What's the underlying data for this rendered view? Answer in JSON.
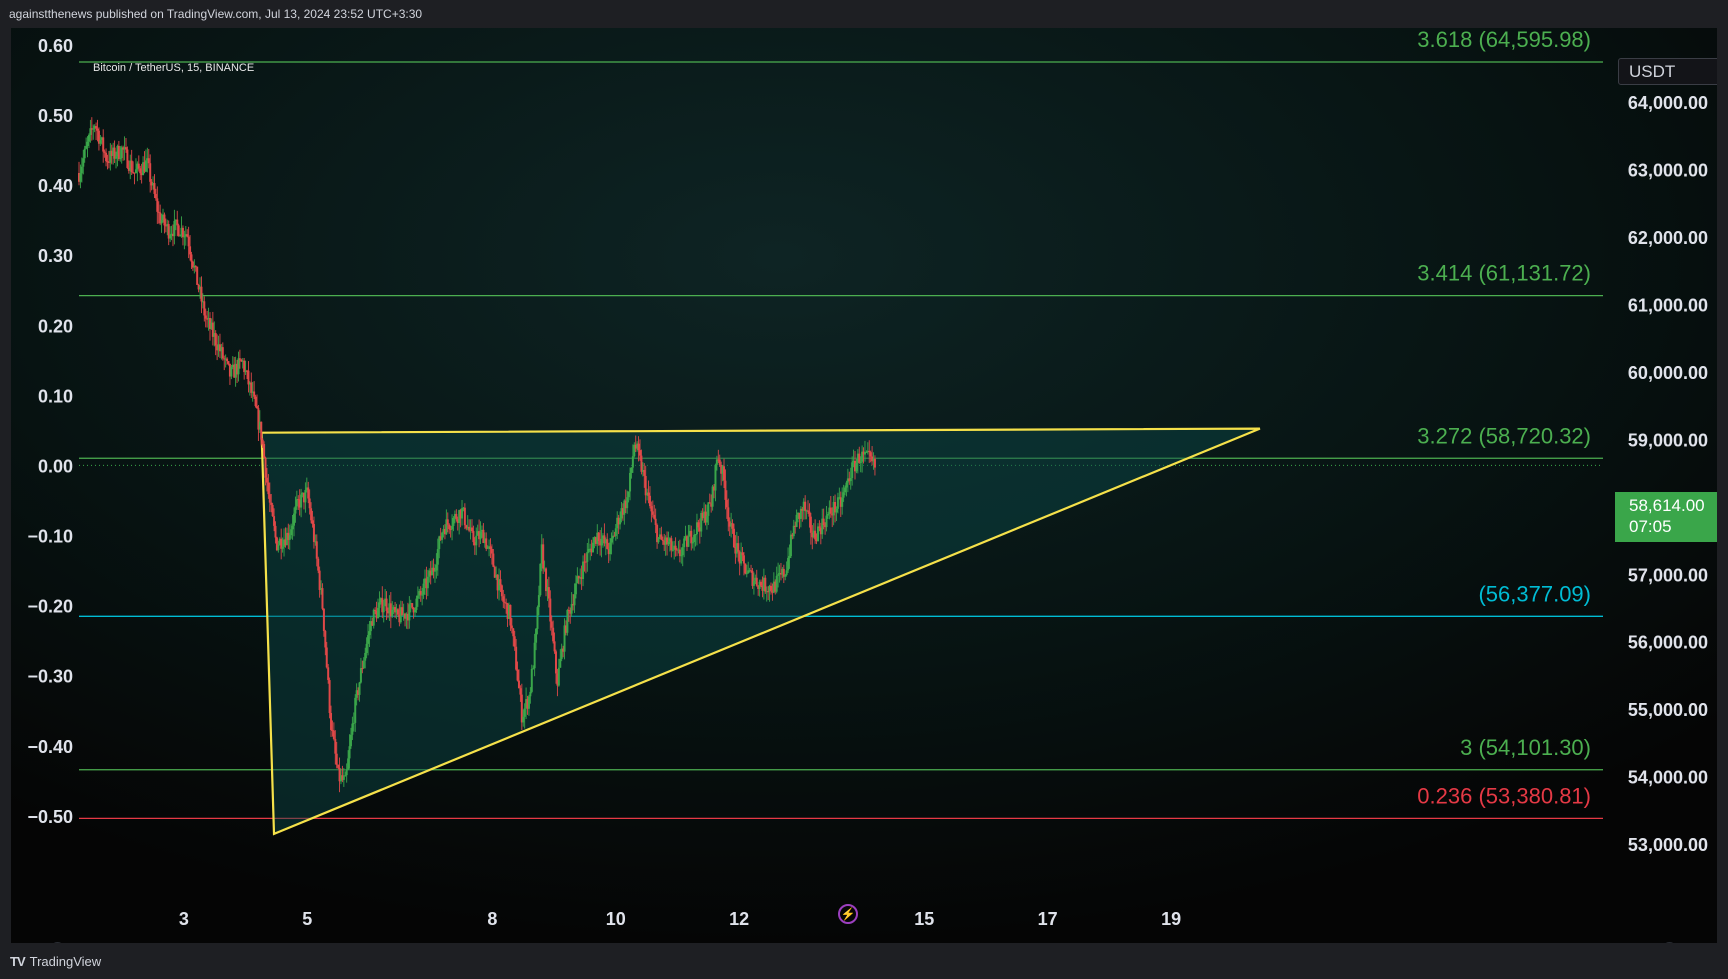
{
  "publisher_text": "againstthenews published on TradingView.com, Jul 13, 2024 23:52 UTC+3:30",
  "symbol_text": "Bitcoin / TetherUS, 15, BINANCE",
  "currency_label": "USDT",
  "current_price": {
    "value": "58,614.00",
    "countdown": "07:05",
    "color": "#3aa64a"
  },
  "footer_brand": "TradingView",
  "footer_icon": "tradingview-logo-icon",
  "flash_icon": "lightning-icon",
  "zoom_left_label": "Z",
  "zoom_right_label": "A",
  "colors": {
    "background": "#070707",
    "fib_green": "#4caf50",
    "fib_cyan": "#00bcd4",
    "fib_red": "#e53945",
    "triangle": "#f5e14a",
    "candle_up": "#3aa64a",
    "candle_down": "#e04848"
  },
  "chart_data": {
    "type": "candlestick",
    "x_axis": {
      "ticks": [
        {
          "label": "3",
          "x": 3.0
        },
        {
          "label": "5",
          "x": 5.0
        },
        {
          "label": "8",
          "x": 8.0
        },
        {
          "label": "10",
          "x": 10.0
        },
        {
          "label": "12",
          "x": 12.0
        },
        {
          "label": "15",
          "x": 15.0
        },
        {
          "label": "17",
          "x": 17.0
        },
        {
          "label": "19",
          "x": 19.0
        }
      ],
      "range": [
        1.3,
        26.0
      ]
    },
    "y_right": {
      "ticks": [
        64000,
        63000,
        62000,
        61000,
        60000,
        59000,
        58000,
        57000,
        56000,
        55000,
        54000,
        53000
      ],
      "tick_labels": [
        "64,000.00",
        "63,000.00",
        "62,000.00",
        "61,000.00",
        "60,000.00",
        "59,000.00",
        "58,000.00",
        "57,000.00",
        "56,000.00",
        "55,000.00",
        "54,000.00",
        "53,000.00"
      ],
      "range": [
        52200,
        65100
      ]
    },
    "y_left": {
      "ticks": [
        0.6,
        0.5,
        0.4,
        0.3,
        0.2,
        0.1,
        0.0,
        -0.1,
        -0.2,
        -0.3,
        -0.4,
        -0.5
      ],
      "tick_labels": [
        "0.60",
        "0.50",
        "0.40",
        "0.30",
        "0.20",
        "0.10",
        "0.00",
        "−0.10",
        "−0.20",
        "−0.30",
        "−0.40",
        "−0.50"
      ],
      "zero_price": 58614,
      "unit_price": 10392
    },
    "fib_levels": [
      {
        "label": "3.618 (64,595.98)",
        "price": 64595.98,
        "color": "#4caf50"
      },
      {
        "label": "3.414 (61,131.72)",
        "price": 61131.72,
        "color": "#4caf50"
      },
      {
        "label": "3.272 (58,720.32)",
        "price": 58720.32,
        "color": "#4caf50"
      },
      {
        "label": "(56,377.09)",
        "price": 56377.09,
        "color": "#00bcd4"
      },
      {
        "label": "3 (54,101.30)",
        "price": 54101.3,
        "color": "#4caf50"
      },
      {
        "label": "0.236 (53,380.81)",
        "price": 53380.81,
        "color": "#e53945"
      }
    ],
    "current_price": 58614,
    "triangle": [
      {
        "x": 4.26,
        "price": 59100
      },
      {
        "x": 20.44,
        "price": 59160
      },
      {
        "x": 4.46,
        "price": 53150
      }
    ],
    "price_path": [
      [
        1.3,
        62950
      ],
      [
        1.55,
        63700
      ],
      [
        1.75,
        63150
      ],
      [
        2.0,
        63300
      ],
      [
        2.2,
        62950
      ],
      [
        2.4,
        63100
      ],
      [
        2.6,
        62300
      ],
      [
        2.75,
        62100
      ],
      [
        2.9,
        62150
      ],
      [
        3.05,
        62050
      ],
      [
        3.2,
        61400
      ],
      [
        3.35,
        60800
      ],
      [
        3.55,
        60400
      ],
      [
        3.75,
        59950
      ],
      [
        3.95,
        60150
      ],
      [
        4.12,
        59600
      ],
      [
        4.26,
        59050
      ],
      [
        4.38,
        58100
      ],
      [
        4.5,
        57450
      ],
      [
        4.7,
        57600
      ],
      [
        4.85,
        58050
      ],
      [
        5.0,
        58200
      ],
      [
        5.1,
        57600
      ],
      [
        5.25,
        56500
      ],
      [
        5.38,
        54800
      ],
      [
        5.5,
        54000
      ],
      [
        5.62,
        53900
      ],
      [
        5.75,
        54900
      ],
      [
        5.9,
        55700
      ],
      [
        6.05,
        56350
      ],
      [
        6.25,
        56600
      ],
      [
        6.45,
        56350
      ],
      [
        6.65,
        56450
      ],
      [
        6.85,
        56700
      ],
      [
        7.05,
        57100
      ],
      [
        7.2,
        57700
      ],
      [
        7.35,
        57800
      ],
      [
        7.5,
        57950
      ],
      [
        7.68,
        57500
      ],
      [
        7.85,
        57600
      ],
      [
        8.0,
        57200
      ],
      [
        8.15,
        56650
      ],
      [
        8.28,
        56400
      ],
      [
        8.38,
        55700
      ],
      [
        8.48,
        54900
      ],
      [
        8.6,
        55200
      ],
      [
        8.7,
        56000
      ],
      [
        8.8,
        57350
      ],
      [
        8.92,
        56500
      ],
      [
        9.05,
        55400
      ],
      [
        9.2,
        56300
      ],
      [
        9.35,
        56800
      ],
      [
        9.5,
        57200
      ],
      [
        9.7,
        57600
      ],
      [
        9.9,
        57350
      ],
      [
        10.05,
        57850
      ],
      [
        10.2,
        58150
      ],
      [
        10.3,
        58950
      ],
      [
        10.4,
        58650
      ],
      [
        10.55,
        58000
      ],
      [
        10.7,
        57500
      ],
      [
        10.85,
        57450
      ],
      [
        11.0,
        57250
      ],
      [
        11.2,
        57550
      ],
      [
        11.4,
        57800
      ],
      [
        11.55,
        58050
      ],
      [
        11.65,
        58800
      ],
      [
        11.75,
        58400
      ],
      [
        11.85,
        57700
      ],
      [
        12.0,
        57250
      ],
      [
        12.15,
        57000
      ],
      [
        12.35,
        56850
      ],
      [
        12.55,
        56800
      ],
      [
        12.75,
        57050
      ],
      [
        12.9,
        57750
      ],
      [
        13.05,
        58000
      ],
      [
        13.2,
        57550
      ],
      [
        13.35,
        57750
      ],
      [
        13.5,
        57950
      ],
      [
        13.65,
        58050
      ],
      [
        13.8,
        58500
      ],
      [
        13.95,
        58750
      ],
      [
        14.1,
        58700
      ],
      [
        14.2,
        58580
      ]
    ]
  }
}
